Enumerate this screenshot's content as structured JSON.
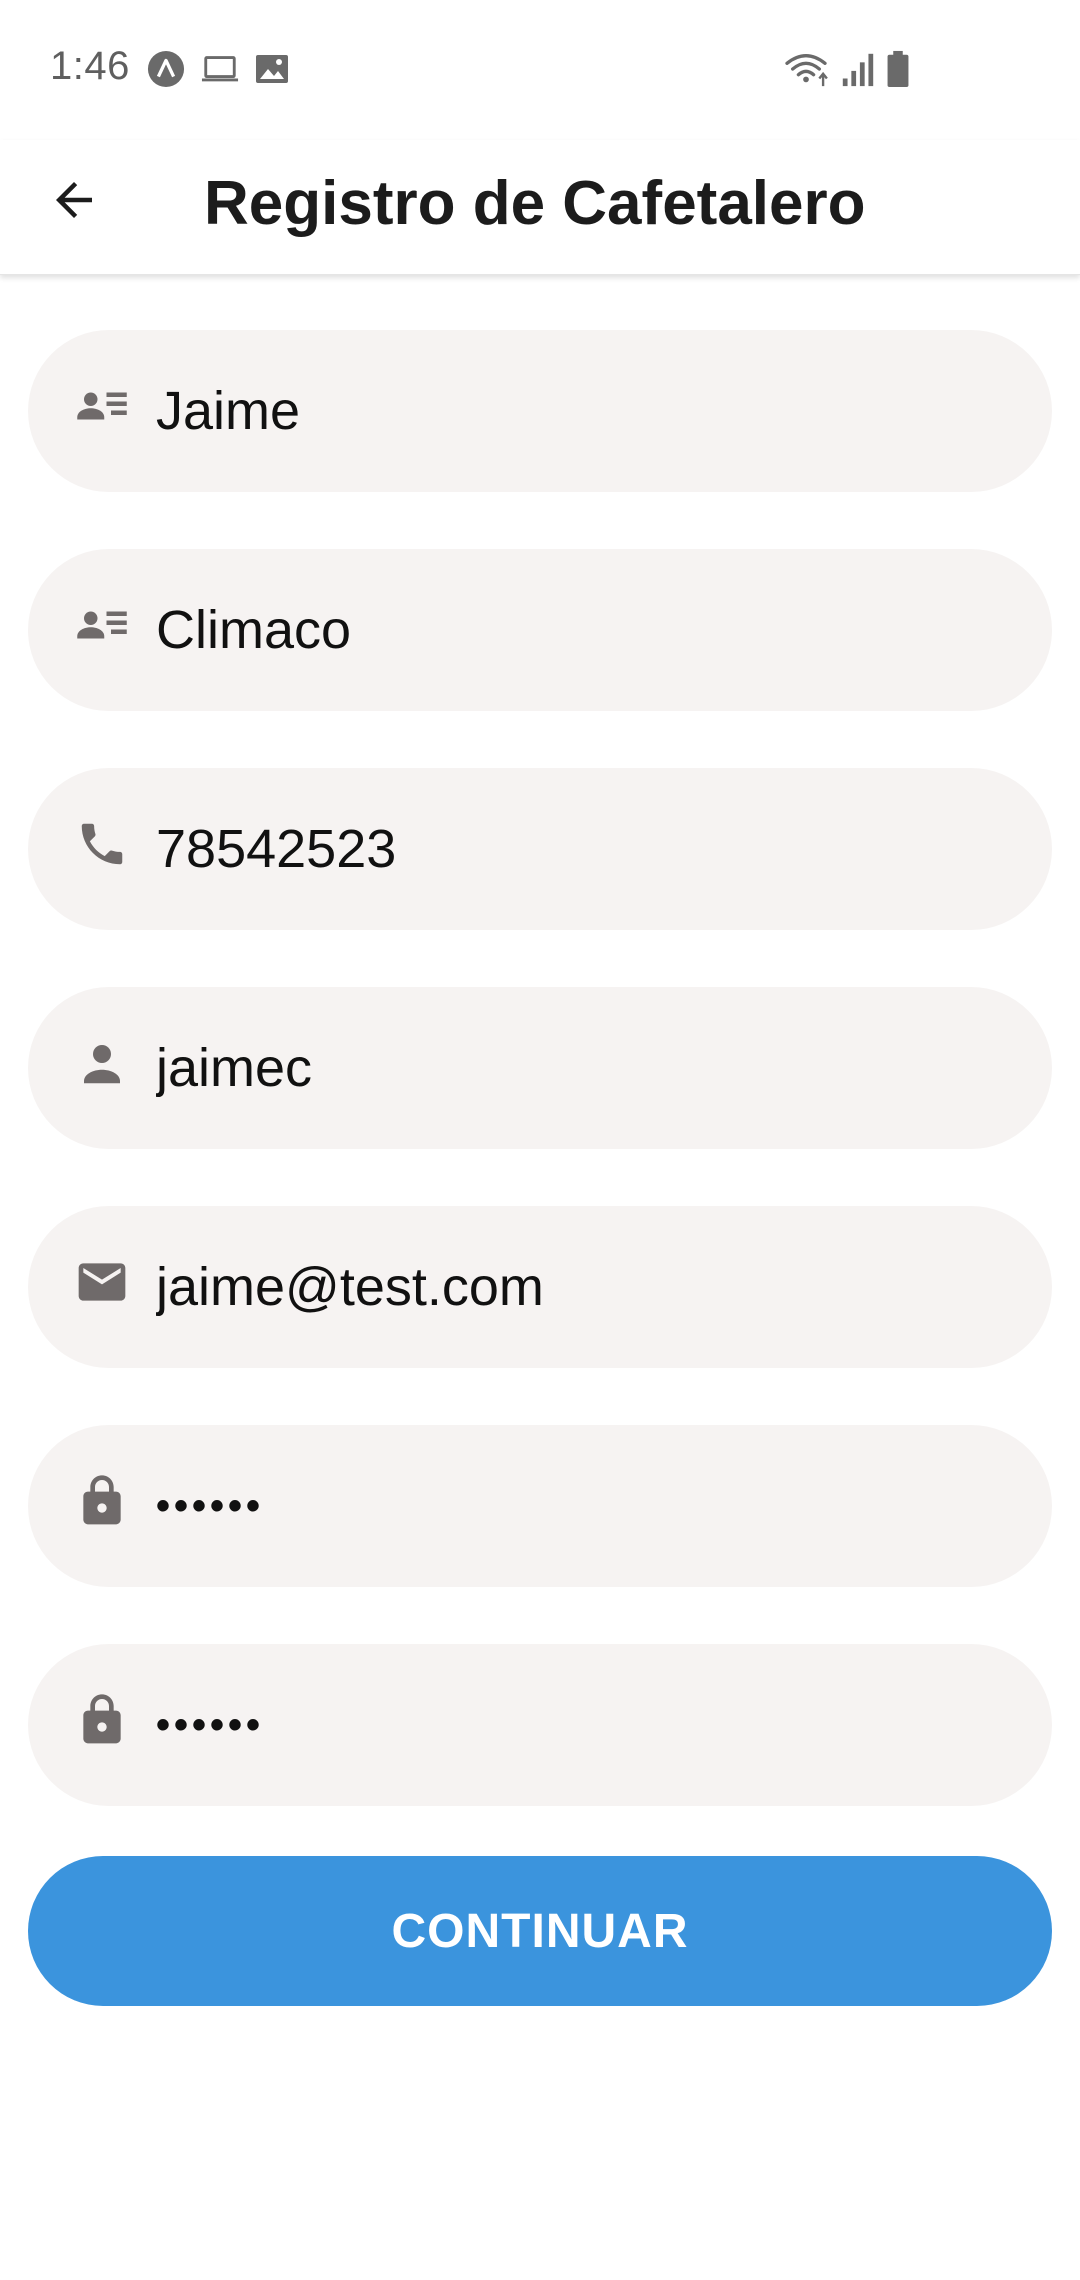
{
  "status_bar": {
    "time": "1:46",
    "icons": [
      "app-notification-icon",
      "laptop-icon",
      "image-icon",
      "wifi-icon",
      "signal-icon",
      "battery-icon"
    ]
  },
  "app_bar": {
    "title": "Registro de Cafetalero",
    "back_icon": "arrow-back-icon"
  },
  "form": {
    "fields": [
      {
        "icon": "contact-card-icon",
        "value": "Jaime"
      },
      {
        "icon": "contact-card-icon",
        "value": "Climaco"
      },
      {
        "icon": "phone-icon",
        "value": "78542523"
      },
      {
        "icon": "person-icon",
        "value": "jaimec"
      },
      {
        "icon": "mail-icon",
        "value": "jaime@test.com"
      },
      {
        "icon": "lock-icon",
        "value": "••••••"
      },
      {
        "icon": "lock-icon",
        "value": "••••••"
      }
    ]
  },
  "continue_button": {
    "label": "CONTINUAR"
  },
  "colors": {
    "accent": "#3b94dd",
    "field_background": "#f6f3f2",
    "icon": "#6f6a6a"
  }
}
